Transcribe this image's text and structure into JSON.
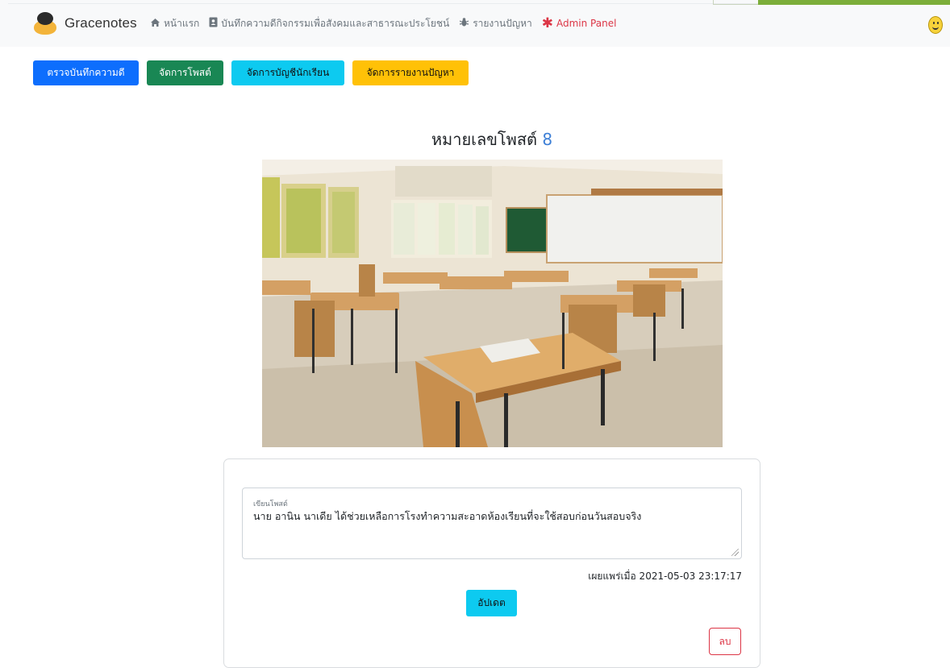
{
  "navbar": {
    "brand": "Gracenotes",
    "links": [
      {
        "icon": "home-icon",
        "label": "หน้าแรก"
      },
      {
        "icon": "contact-book-icon",
        "label": "บันทึกความดีกิจกรรมเพื่อสังคมและสาธารณะประโยชน์"
      },
      {
        "icon": "bug-icon",
        "label": "รายงานปัญหา"
      },
      {
        "icon": "asterisk-icon",
        "label": "Admin Panel"
      }
    ]
  },
  "admin_buttons": [
    {
      "label": "ตรวจบันทึกความดี",
      "color": "#0d6efd"
    },
    {
      "label": "จัดการโพสต์",
      "color": "#198754"
    },
    {
      "label": "จัดการบัญชีนักเรียน",
      "color": "#0dcaf0"
    },
    {
      "label": "จัดการรายงานปัญหา",
      "color": "#ffc107"
    }
  ],
  "post": {
    "title_prefix": "หมายเลขโพสต์",
    "number": "8",
    "field_label": "เขียนโพสต์",
    "content": "นาย อานิน นาเดีย ได้ช่วยเหลือการโรงทำความสะอาดห้องเรียนที่จะใช้สอบก่อนวันสอบจริง",
    "published": "เผยแพร่เมื่อ 2021-05-03 23:17:17",
    "update_label": "อัปเดต",
    "delete_label": "ลบ"
  },
  "colors": {
    "primary": "#0d6efd",
    "success": "#198754",
    "info": "#0dcaf0",
    "warning": "#ffc107",
    "danger": "#dc3545"
  }
}
